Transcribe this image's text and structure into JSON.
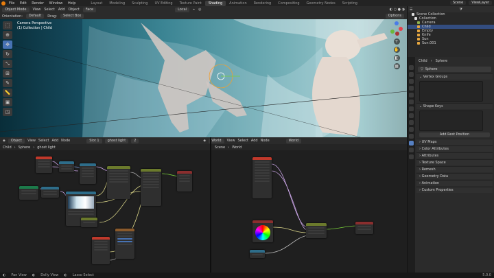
{
  "topbar": {
    "menus": [
      "File",
      "Edit",
      "Render",
      "Window",
      "Help"
    ],
    "workspaces": [
      "Layout",
      "Modeling",
      "Sculpting",
      "UV Editing",
      "Texture Paint",
      "Shading",
      "Animation",
      "Rendering",
      "Compositing",
      "Geometry Nodes",
      "Scripting"
    ],
    "active_workspace": "Shading",
    "scene": "Scene",
    "view_layer": "ViewLayer"
  },
  "viewport": {
    "mode": "Object Mode",
    "menus": [
      "View",
      "Select",
      "Add",
      "Object"
    ],
    "face_label": "Face",
    "orientation_label": "Orientation:",
    "orientation": "Default",
    "drag_label": "Drag:",
    "drag": "Select Box",
    "pivot": "Local",
    "options": "Options",
    "camera_title": "Camera Perspective",
    "camera_sub": "(1) Collection | Child"
  },
  "node_left": {
    "editor": "Object",
    "menus": [
      "View",
      "Select",
      "Add",
      "Node"
    ],
    "slot": "Slot 1",
    "material": "ghost light",
    "users": "2",
    "breadcrumb": [
      "Child",
      "Sphere",
      "ghost light"
    ]
  },
  "node_right": {
    "editor": "World",
    "menus": [
      "View",
      "Select",
      "Add",
      "Node"
    ],
    "world": "World",
    "breadcrumb": [
      "Scene",
      "World"
    ]
  },
  "outliner": {
    "title": "Scene Collection",
    "items": [
      {
        "name": "Collection",
        "color": "#dcdcdc"
      },
      {
        "name": "Camera",
        "color": "#8fb34d"
      },
      {
        "name": "Child",
        "color": "#e8a840"
      },
      {
        "name": "Empty",
        "color": "#e8a840"
      },
      {
        "name": "Knife",
        "color": "#e8a840"
      },
      {
        "name": "Sun",
        "color": "#e8a840"
      },
      {
        "name": "Sun.001",
        "color": "#e8a840"
      }
    ],
    "selected": "Child"
  },
  "props": {
    "breadcrumb": [
      "Child",
      "Sphere"
    ],
    "mesh_name": "Sphere",
    "sections": [
      "Vertex Groups",
      "Shape Keys"
    ],
    "add_rest": "Add Rest Position",
    "collapsed": [
      "UV Maps",
      "Color Attributes",
      "Attributes",
      "Texture Space",
      "Remesh",
      "Geometry Data",
      "Animation",
      "Custom Properties"
    ]
  },
  "status": {
    "items": [
      "Pan View",
      "Dolly View",
      "Lasso Select"
    ],
    "version": "5.0.0"
  }
}
